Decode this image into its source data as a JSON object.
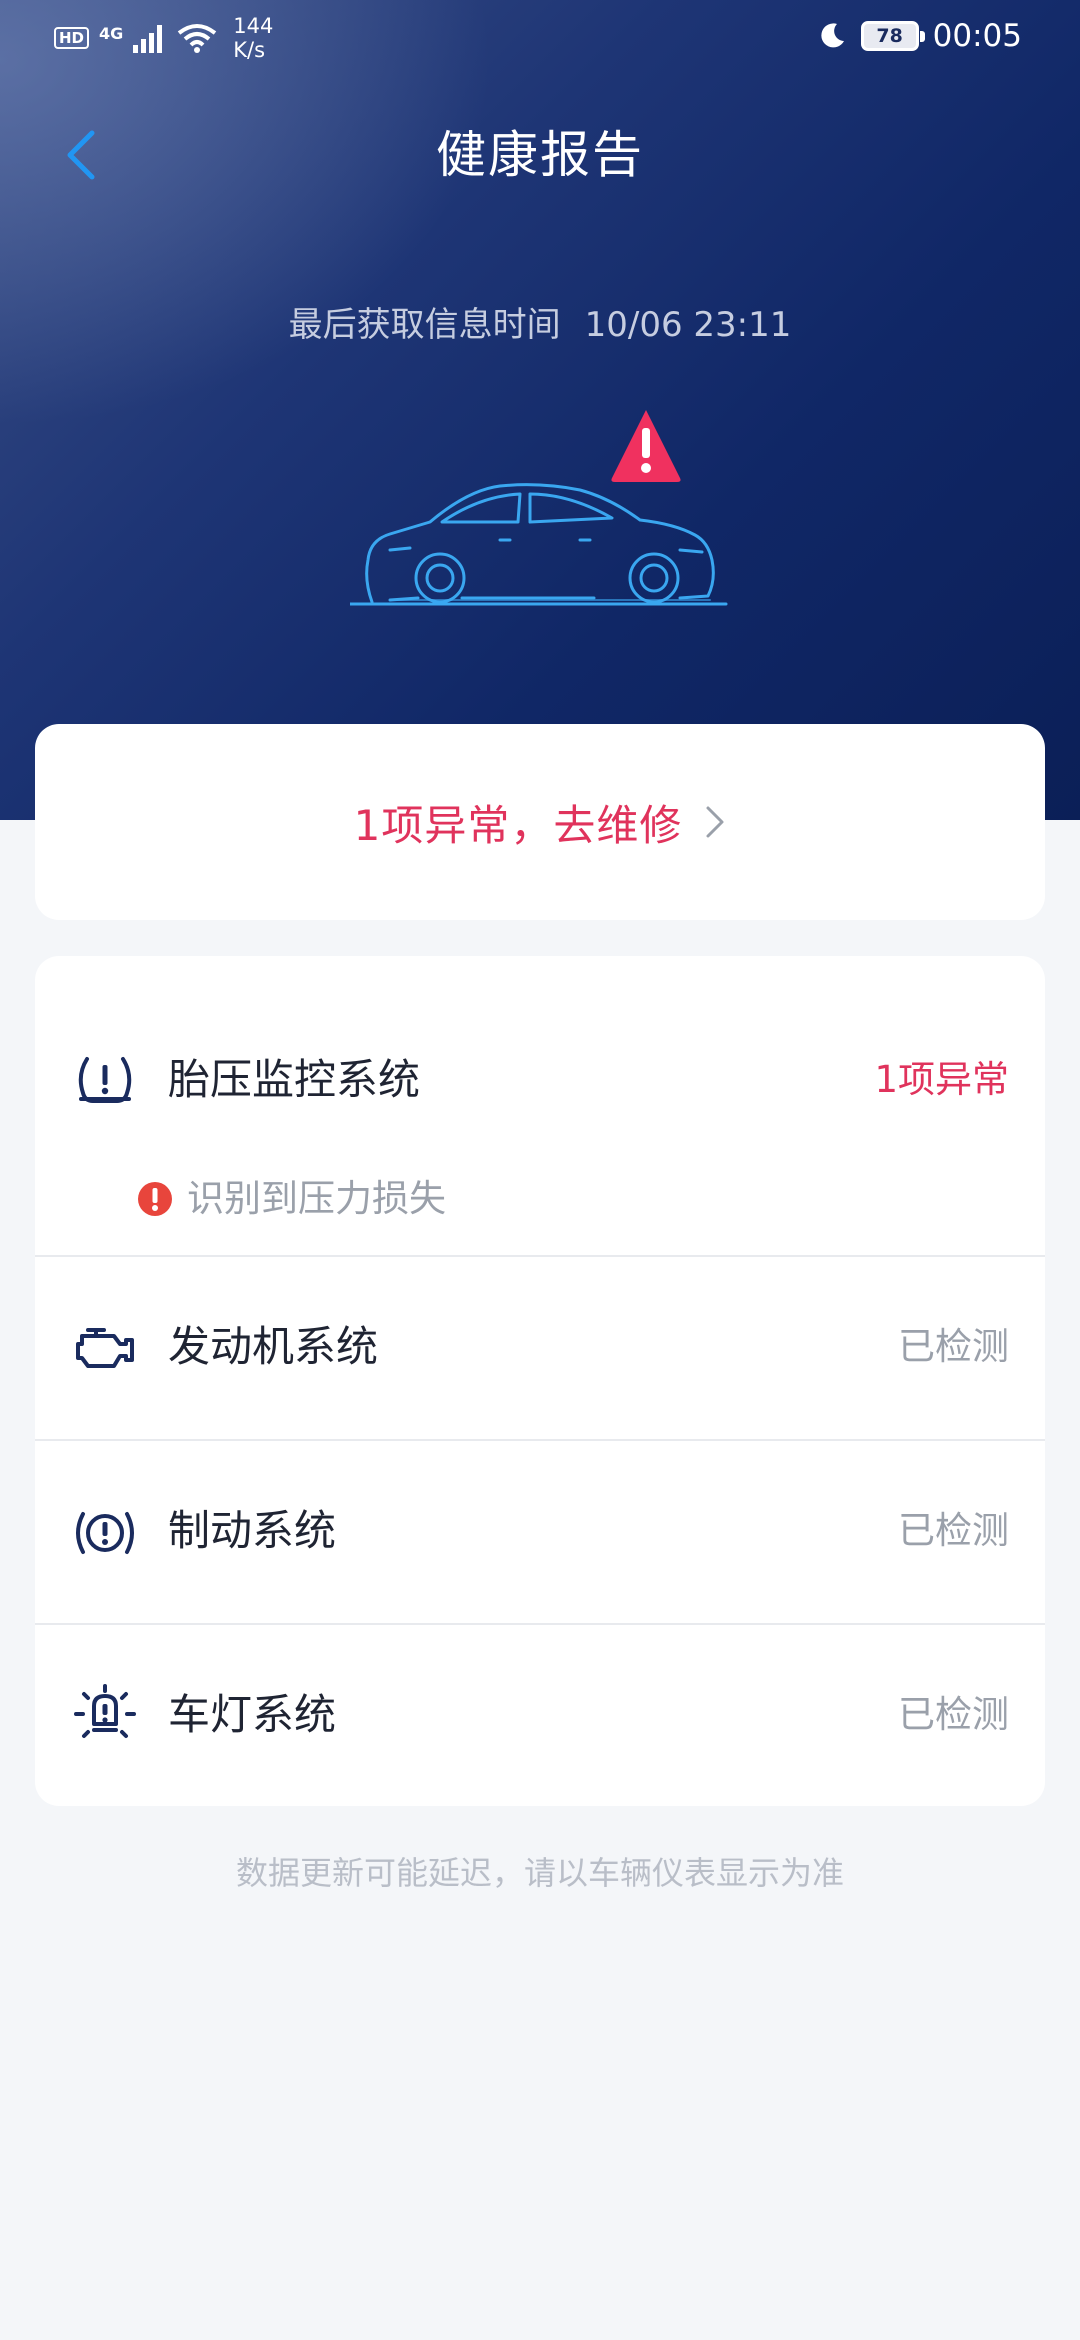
{
  "status_bar": {
    "hd": "HD",
    "network": "4G",
    "speed_value": "144",
    "speed_unit": "K/s",
    "battery": "78",
    "time": "00:05"
  },
  "header": {
    "title": "健康报告",
    "last_fetch_label": "最后获取信息时间",
    "last_fetch_time": "10/06 23:11"
  },
  "alert_card": {
    "text": "1项异常，去维修"
  },
  "systems": [
    {
      "label": "胎压监控系统",
      "status": "1项异常",
      "icon": "tire-pressure-icon"
    },
    {
      "label": "发动机系统",
      "status": "已检测",
      "icon": "engine-icon"
    },
    {
      "label": "制动系统",
      "status": "已检测",
      "icon": "brake-icon"
    },
    {
      "label": "车灯系统",
      "status": "已检测",
      "icon": "lamp-icon"
    }
  ],
  "tire_detail": {
    "text": "识别到压力损失"
  },
  "footnote": "数据更新可能延迟，请以车辆仪表显示为准",
  "colors": {
    "accent_red": "#e0335c",
    "header_navy": "#102766",
    "back_blue": "#2196f3",
    "car_line": "#3aa7f0"
  }
}
